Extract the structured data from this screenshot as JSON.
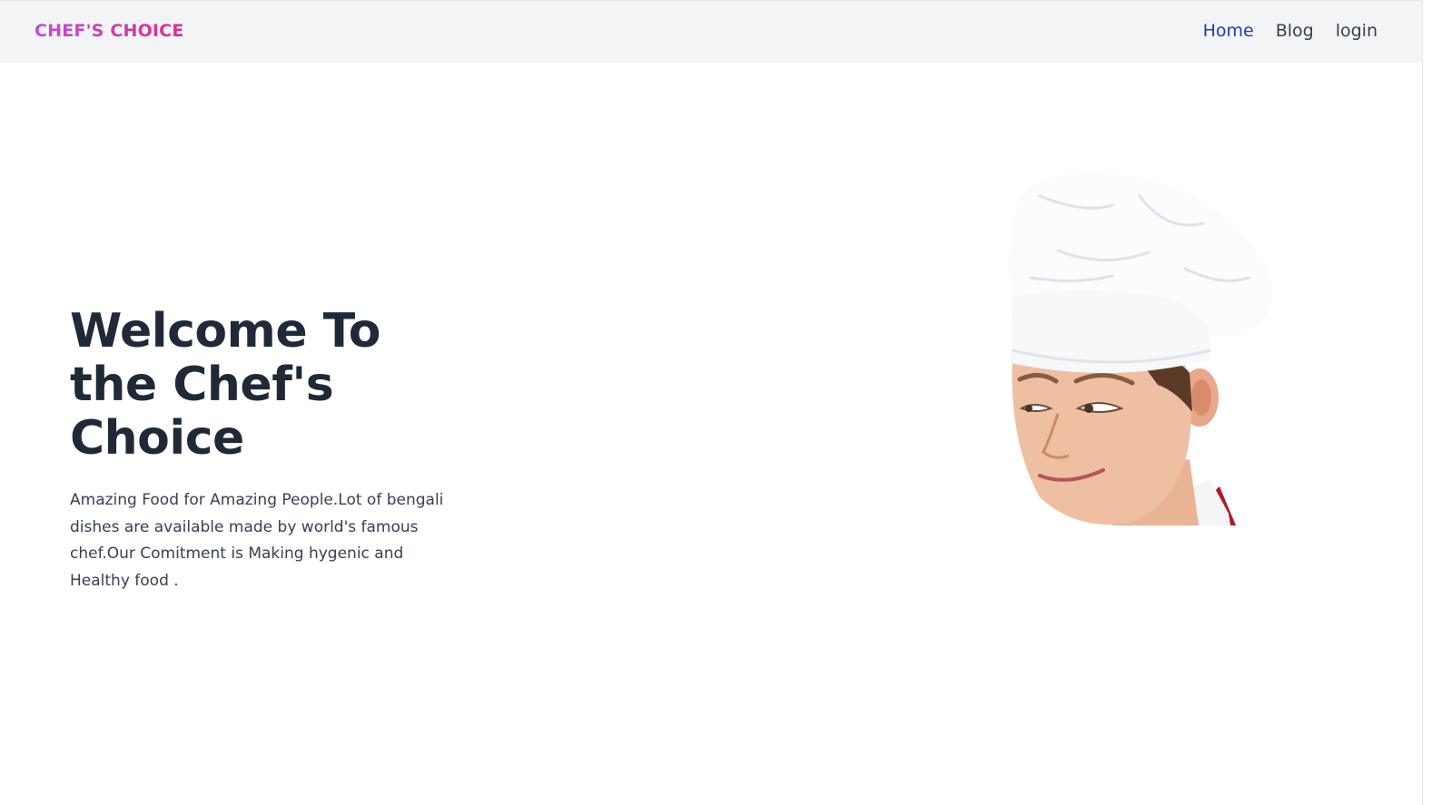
{
  "navbar": {
    "brand": "CHEF'S CHOICE",
    "links": [
      {
        "label": "Home",
        "active": true
      },
      {
        "label": "Blog",
        "active": false
      },
      {
        "label": "login",
        "active": false
      }
    ]
  },
  "hero": {
    "title_lines": [
      "Welcome To",
      "the Chef's",
      "Choice"
    ],
    "description": "Amazing Food for Amazing People.Lot of bengali dishes are available made by world's famous chef.Our Comitment is Making hygenic and Healthy food ."
  },
  "colors": {
    "brand_gradient_start": "#c04fd8",
    "brand_gradient_end": "#de2d8c",
    "nav_active": "#1e40af",
    "nav_default": "#374151",
    "heading": "#1f2937",
    "navbar_bg": "#f3f4f6"
  },
  "icons": {
    "hero_image": "chef-portrait-image"
  }
}
